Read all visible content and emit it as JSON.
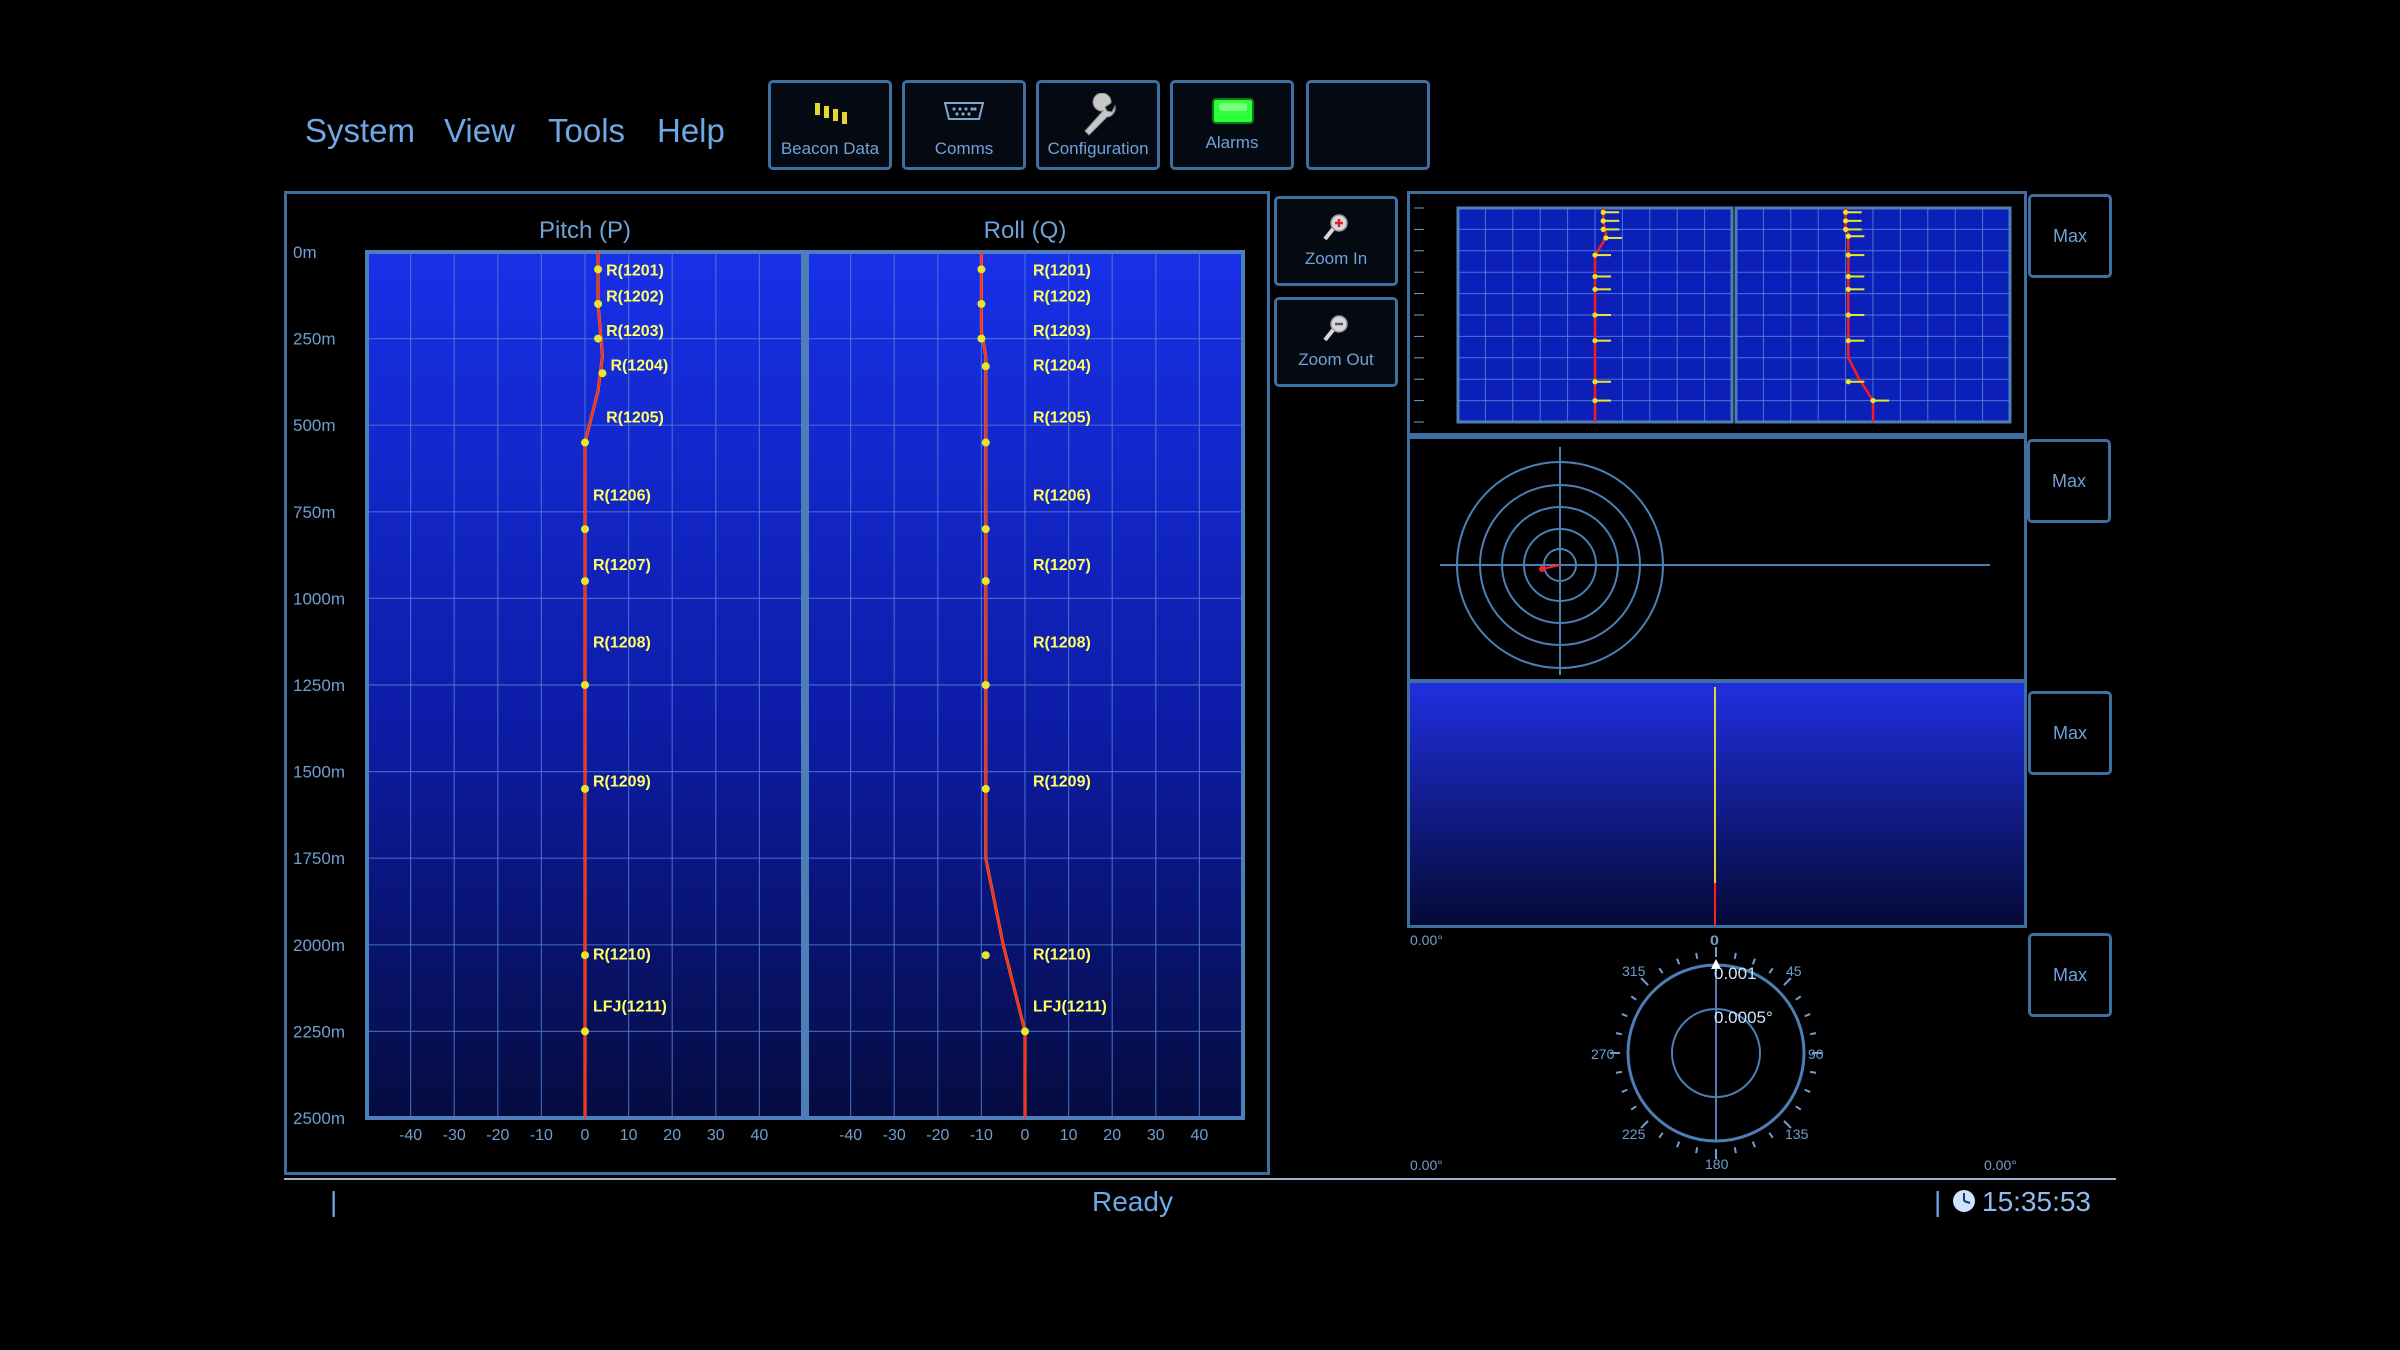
{
  "menu": [
    "System",
    "View",
    "Tools",
    "Help"
  ],
  "toolbar": [
    {
      "label": "Beacon Data",
      "icon": "beacon-bars-icon"
    },
    {
      "label": "Comms",
      "icon": "serial-port-icon"
    },
    {
      "label": "Configuration",
      "icon": "wrench-icon"
    },
    {
      "label": "Alarms",
      "icon": "alarm-led-icon"
    },
    {
      "label": "",
      "icon": ""
    }
  ],
  "side_buttons": {
    "zoom_in": "Zoom In",
    "zoom_out": "Zoom Out"
  },
  "max_label": "Max",
  "colors": {
    "accent": "#3f6f9e",
    "trace": "#ff1a1a",
    "beacon": "#e8e82a",
    "label": "#ffff66"
  },
  "chart_data": {
    "type": "line",
    "depth_ticks": [
      "0m",
      "250m",
      "500m",
      "750m",
      "1000m",
      "1250m",
      "1500m",
      "1750m",
      "2000m",
      "2250m",
      "2500m"
    ],
    "x_ticks": [
      -40,
      -30,
      -20,
      -10,
      0,
      10,
      20,
      30,
      40
    ],
    "xlim": [
      -50,
      50
    ],
    "ylim": [
      0,
      2500
    ],
    "pitch": {
      "title": "Pitch (P)",
      "line": [
        [
          3,
          0
        ],
        [
          3,
          150
        ],
        [
          4,
          300
        ],
        [
          3,
          400
        ],
        [
          0,
          550
        ],
        [
          0,
          800
        ],
        [
          0,
          2500
        ]
      ],
      "dots": [
        [
          3,
          50
        ],
        [
          3,
          150
        ],
        [
          3,
          250
        ],
        [
          4,
          350
        ],
        [
          0,
          550
        ],
        [
          0,
          800
        ],
        [
          0,
          950
        ],
        [
          0,
          1250
        ],
        [
          0,
          1550
        ],
        [
          0,
          2030
        ],
        [
          0,
          2250
        ]
      ]
    },
    "roll": {
      "title": "Roll (Q)",
      "line": [
        [
          -10,
          0
        ],
        [
          -10,
          230
        ],
        [
          -9,
          300
        ],
        [
          -9,
          550
        ],
        [
          -9,
          1750
        ],
        [
          -5,
          2000
        ],
        [
          0,
          2250
        ],
        [
          0,
          2500
        ]
      ],
      "dots": [
        [
          -10,
          50
        ],
        [
          -10,
          150
        ],
        [
          -10,
          250
        ],
        [
          -9,
          330
        ],
        [
          -9,
          550
        ],
        [
          -9,
          800
        ],
        [
          -9,
          950
        ],
        [
          -9,
          1250
        ],
        [
          -9,
          1550
        ],
        [
          -9,
          2030
        ],
        [
          0,
          2250
        ]
      ]
    },
    "beacons": [
      {
        "label": "R(1201)",
        "depth": 50
      },
      {
        "label": "R(1202)",
        "depth": 125
      },
      {
        "label": "R(1203)",
        "depth": 225
      },
      {
        "label": "R(1204)",
        "depth": 325
      },
      {
        "label": "R(1205)",
        "depth": 475
      },
      {
        "label": "R(1206)",
        "depth": 700
      },
      {
        "label": "R(1207)",
        "depth": 900
      },
      {
        "label": "R(1208)",
        "depth": 1125
      },
      {
        "label": "R(1209)",
        "depth": 1525
      },
      {
        "label": "R(1210)",
        "depth": 2025
      },
      {
        "label": "LFJ(1211)",
        "depth": 2175
      }
    ]
  },
  "readouts": {
    "bar_left": "0.00°",
    "bar_top": "0",
    "compass_val1": "0.001",
    "compass_val2": "0.0005°",
    "compass_labels": {
      "n": "0",
      "ne": "45",
      "e": "90",
      "se": "135",
      "s": "180",
      "sw": "225",
      "w": "270",
      "nw": "315"
    },
    "bottom_left": "0.00°",
    "bottom_right": "0.00°"
  },
  "status": {
    "left_sep": "|",
    "text": "Ready",
    "right_sep": "|",
    "time": "15:35:53"
  }
}
